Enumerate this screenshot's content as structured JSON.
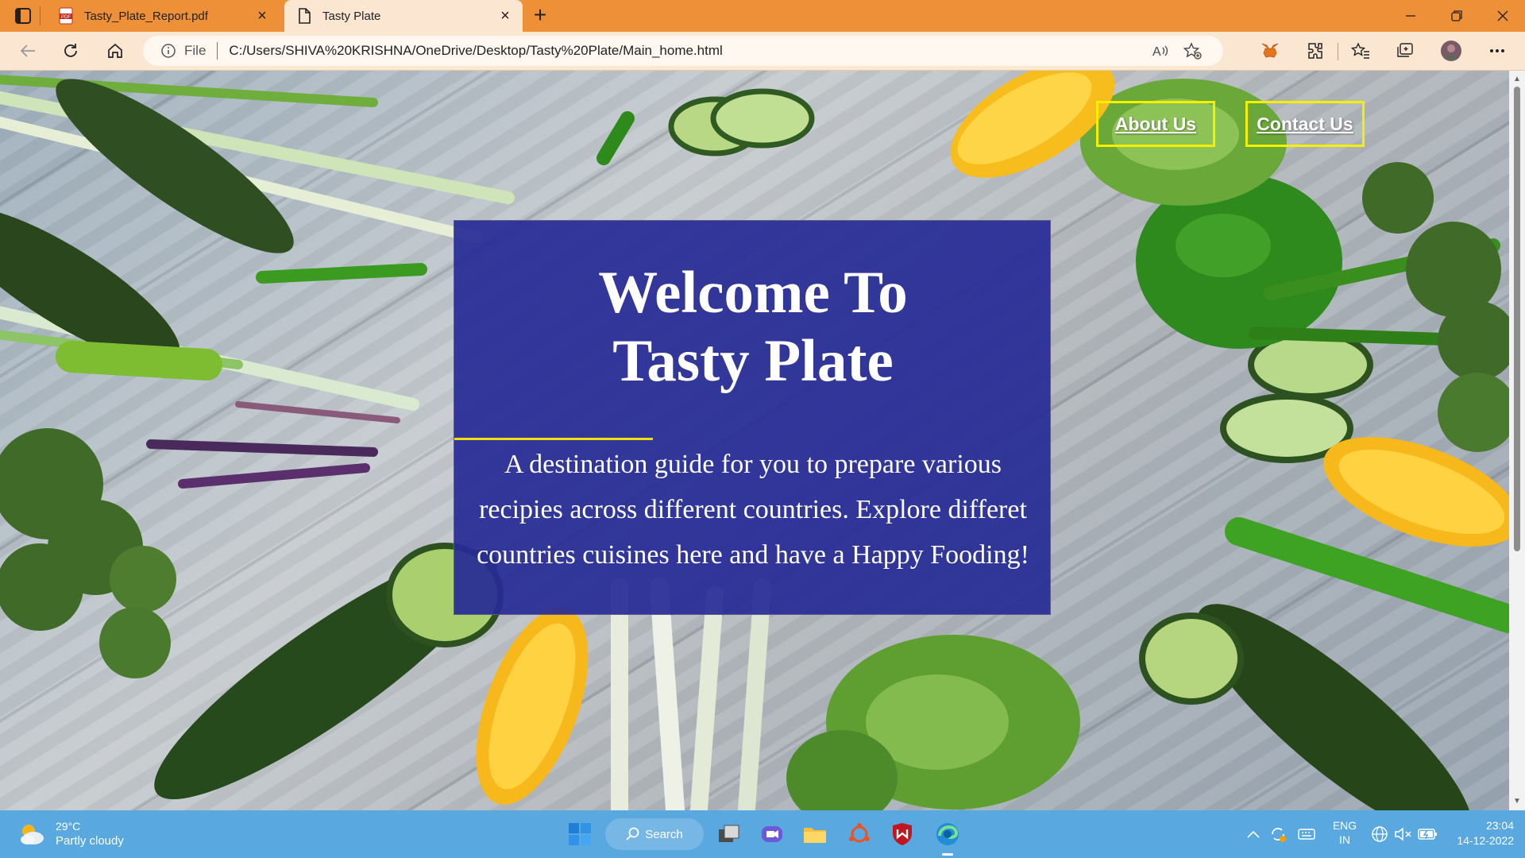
{
  "browser": {
    "tabs": [
      {
        "title": "Tasty_Plate_Report.pdf",
        "icon": "pdf-icon",
        "active": false
      },
      {
        "title": "Tasty Plate",
        "icon": "page-icon",
        "active": true
      }
    ],
    "address": {
      "scheme_label": "File",
      "url": "C:/Users/SHIVA%20KRISHNA/OneDrive/Desktop/Tasty%20Plate/Main_home.html"
    },
    "colors": {
      "tabbar": "#ee9037",
      "toolbar": "#fbe6d2"
    }
  },
  "page": {
    "nav": {
      "about": "About Us",
      "contact": "Contact Us"
    },
    "hero": {
      "title_line1": "Welcome To",
      "title_line2": "Tasty Plate",
      "description": "A destination guide for you to prepare various recipies across different countries. Explore differet countries cuisines here and have a Happy Fooding!"
    },
    "colors": {
      "hero_bg": "#262a96",
      "accent_yellow": "#f4f000"
    }
  },
  "taskbar": {
    "weather": {
      "temp": "29°C",
      "condition": "Partly cloudy"
    },
    "search_label": "Search",
    "lang": {
      "line1": "ENG",
      "line2": "IN"
    },
    "clock": {
      "time": "23:04",
      "date": "14-12-2022"
    },
    "colors": {
      "bg": "#5aa8e0"
    }
  }
}
